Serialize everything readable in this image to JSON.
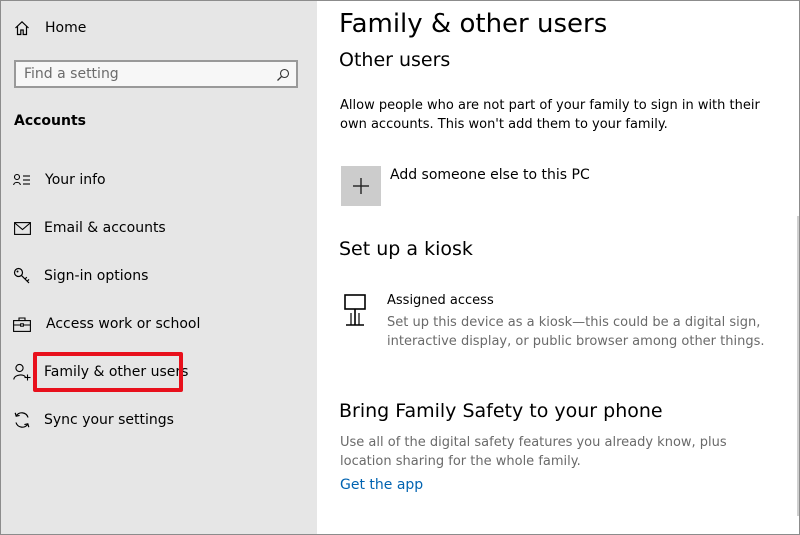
{
  "sidebar": {
    "home_label": "Home",
    "search": {
      "placeholder": "Find a setting",
      "value": ""
    },
    "section_heading": "Accounts",
    "items": [
      {
        "label": "Your info",
        "icon": "your-info-icon"
      },
      {
        "label": "Email & accounts",
        "icon": "mail-icon"
      },
      {
        "label": "Sign-in options",
        "icon": "key-icon"
      },
      {
        "label": "Access work or school",
        "icon": "briefcase-icon"
      },
      {
        "label": "Family & other users",
        "icon": "person-add-icon",
        "selected": true
      },
      {
        "label": "Sync your settings",
        "icon": "sync-icon"
      }
    ],
    "highlight_color": "#e8101c"
  },
  "main": {
    "title": "Family & other users",
    "other_users": {
      "heading": "Other users",
      "description": "Allow people who are not part of your family to sign in with their own accounts. This won't add them to your family.",
      "add_label": "Add someone else to this PC"
    },
    "kiosk": {
      "heading": "Set up a kiosk",
      "item_title": "Assigned access",
      "item_description": "Set up this device as a kiosk—this could be a digital sign, interactive display, or public browser among other things."
    },
    "family_safety": {
      "heading": "Bring Family Safety to your phone",
      "description": "Use all of the digital safety features you already know, plus location sharing for the whole family.",
      "link_label": "Get the app"
    }
  },
  "colors": {
    "sidebar_bg": "#e6e6e6",
    "link": "#0063b1",
    "highlight": "#e8101c"
  }
}
